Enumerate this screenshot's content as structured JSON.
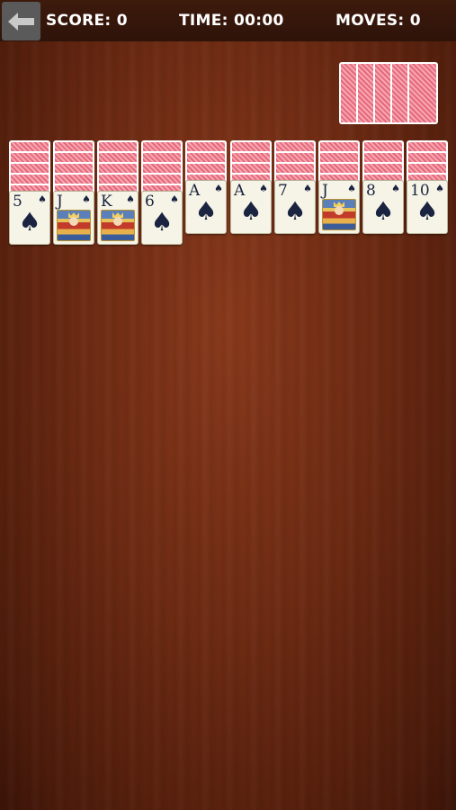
{
  "header": {
    "score_label": "SCORE: 0",
    "time_label": "TIME: 00:00",
    "moves_label": "MOVES: 0"
  },
  "stock": {
    "piles": 5
  },
  "tableau": [
    {
      "hidden": 5,
      "rank": "5",
      "suit": "♠",
      "court": false
    },
    {
      "hidden": 5,
      "rank": "J",
      "suit": "♠",
      "court": true
    },
    {
      "hidden": 5,
      "rank": "K",
      "suit": "♠",
      "court": true
    },
    {
      "hidden": 5,
      "rank": "6",
      "suit": "♠",
      "court": false
    },
    {
      "hidden": 4,
      "rank": "A",
      "suit": "♠",
      "court": false
    },
    {
      "hidden": 4,
      "rank": "A",
      "suit": "♠",
      "court": false
    },
    {
      "hidden": 4,
      "rank": "7",
      "suit": "♠",
      "court": false
    },
    {
      "hidden": 4,
      "rank": "J",
      "suit": "♠",
      "court": true
    },
    {
      "hidden": 4,
      "rank": "8",
      "suit": "♠",
      "court": false
    },
    {
      "hidden": 4,
      "rank": "10",
      "suit": "♠",
      "court": false
    }
  ],
  "colors": {
    "table": "#6e2b13",
    "header": "#2e1309",
    "card_back": "#e46a7b",
    "card_face": "#f6f4e6",
    "suit": "#1a2340"
  },
  "icons": {
    "back": "left-arrow-icon"
  }
}
